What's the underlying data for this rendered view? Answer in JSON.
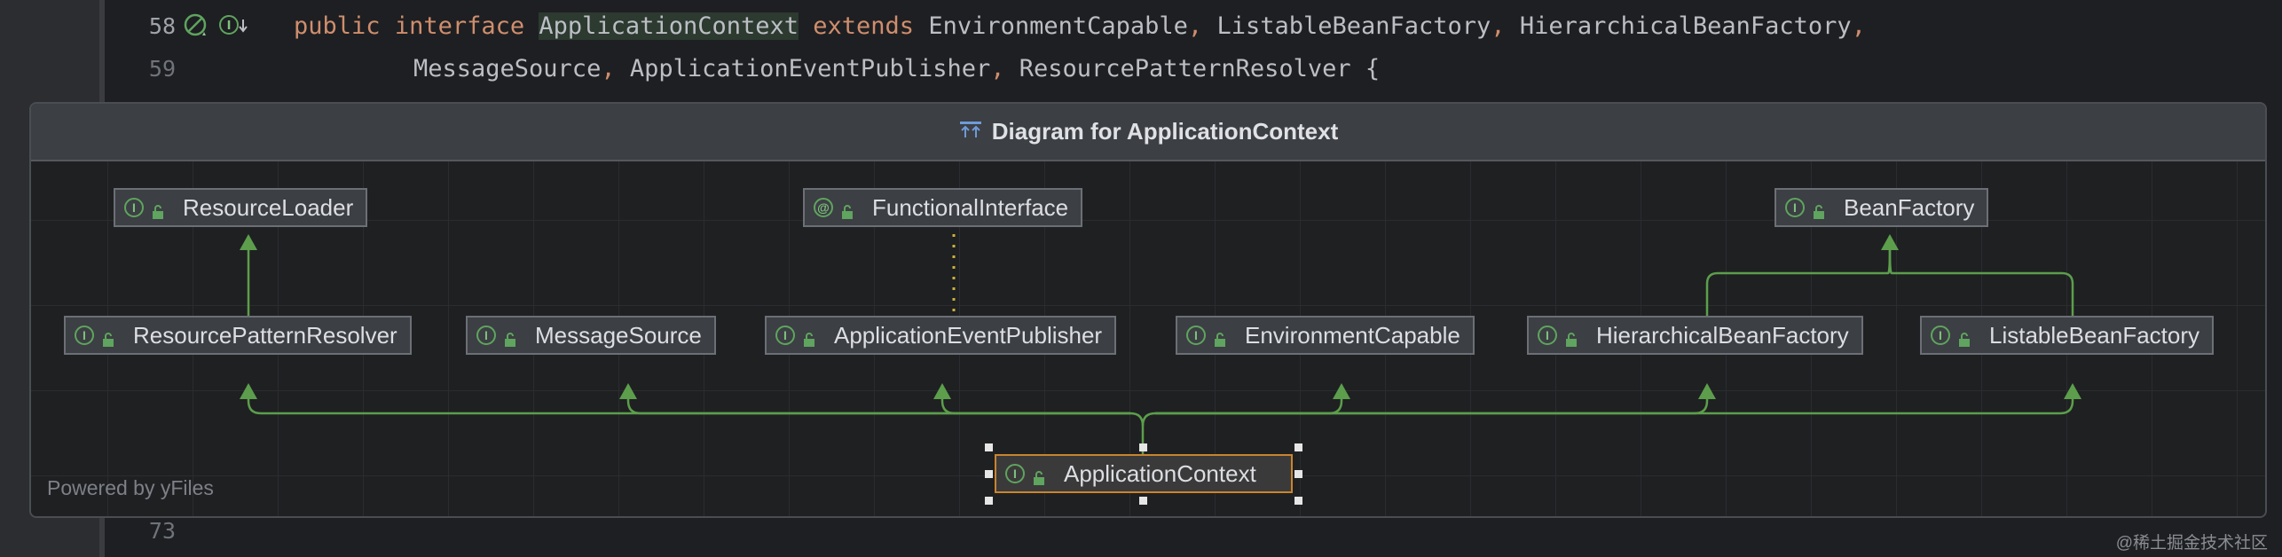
{
  "editor": {
    "line_58_number": "58",
    "line_59_number": "59",
    "line_73_number": "73",
    "line_58": {
      "t1": "public",
      "t2": " ",
      "t3": "interface",
      "t4": " ",
      "t5": "ApplicationContext",
      "t6": " ",
      "t7": "extends",
      "t8": " EnvironmentCapable",
      "t9": ",",
      "t10": " ListableBeanFactory",
      "t11": ",",
      "t12": " HierarchicalBeanFactory",
      "t13": ","
    },
    "line_59": {
      "t1": "MessageSource",
      "t2": ",",
      "t3": " ApplicationEventPublisher",
      "t4": ",",
      "t5": " ResourcePatternResolver {"
    }
  },
  "popup": {
    "title": "Diagram for ApplicationContext",
    "powered_by": "Powered by yFiles",
    "nodes": {
      "resource_loader": "ResourceLoader",
      "functional_interface": "FunctionalInterface",
      "bean_factory": "BeanFactory",
      "resource_pattern_resolver": "ResourcePatternResolver",
      "message_source": "MessageSource",
      "application_event_publisher": "ApplicationEventPublisher",
      "environment_capable": "EnvironmentCapable",
      "hierarchical_bean_factory": "HierarchicalBeanFactory",
      "listable_bean_factory": "ListableBeanFactory",
      "application_context": "ApplicationContext"
    },
    "badges": {
      "interface": "I",
      "annotation": "@"
    }
  },
  "watermark": "@稀土掘金技术社区",
  "colors": {
    "keyword": "#cf8e6d",
    "edge": "#5c9e4c",
    "selected_border": "#c9842e",
    "badge": "#5fa45f"
  }
}
